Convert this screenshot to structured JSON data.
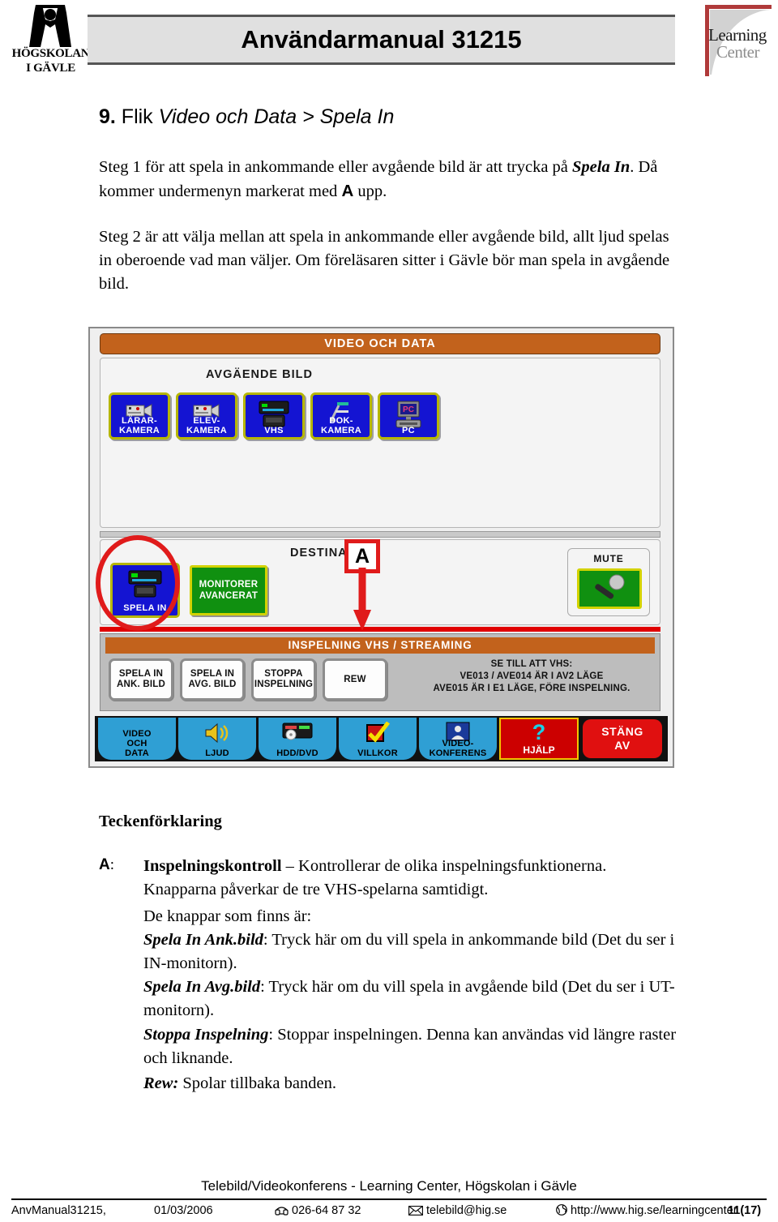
{
  "header": {
    "title": "Användarmanual 31215",
    "hig_logo_line1": "HÖGSKOLAN",
    "hig_logo_line2": "I GÄVLE",
    "lc_logo_line1": "Learning",
    "lc_logo_line2": "Center"
  },
  "section": {
    "number": "9.",
    "lead": " Flik ",
    "title_italic": "Video och Data > Spela In"
  },
  "paragraphs": {
    "p1_a": "Steg 1 för att spela in ankommande eller avgående bild är att trycka på ",
    "p1_b": "Spela In",
    "p1_c": ". Då kommer undermenyn markerat med ",
    "p1_d": "A",
    "p1_e": " upp.",
    "p2": "Steg 2 är att välja mellan att spela in ankommande eller avgående bild, allt ljud spelas in oberoende vad man väljer. Om föreläsaren sitter i Gävle bör man spela in avgående bild."
  },
  "panel": {
    "titlebar": "VIDEO OCH DATA",
    "outgoing_label": "AVGÄENDE BILD",
    "sources": [
      {
        "label_line1": "LÄRAR-",
        "label_line2": "KAMERA",
        "icon": "video-camera-icon"
      },
      {
        "label_line1": "ELEV-",
        "label_line2": "KAMERA",
        "icon": "video-camera-icon"
      },
      {
        "label_line1": "",
        "label_line2": "VHS",
        "icon": "vhs-deck-icon"
      },
      {
        "label_line1": "DOK-",
        "label_line2": "KAMERA",
        "icon": "document-camera-icon"
      },
      {
        "label_line1": "",
        "label_line2": "PC",
        "icon": "pc-monitor-icon"
      }
    ],
    "destination_label": "DESTINATION",
    "spela_in_label": "SPELA IN",
    "monitorer_line1": "MONITORER",
    "monitorer_line2": "AVANCERAT",
    "mute_label": "MUTE",
    "recording_titlebar": "INSPELNING VHS / STREAMING",
    "recording_buttons": [
      {
        "line1": "SPELA IN",
        "line2": "ANK. BILD"
      },
      {
        "line1": "SPELA IN",
        "line2": "AVG. BILD"
      },
      {
        "line1": "STOPPA",
        "line2": "INSPELNING"
      },
      {
        "line1": "REW",
        "line2": ""
      }
    ],
    "recording_note_line1": "SE TILL ATT VHS:",
    "recording_note_line2": "VE013 / AVE014 ÄR I AV2 LÄGE",
    "recording_note_line3": "AVE015 ÄR I E1 LÄGE, FÖRE INSPELNING.",
    "toolbar": [
      {
        "line1": "VIDEO",
        "line2": "OCH",
        "line3": "DATA",
        "icon": ""
      },
      {
        "line1": "LJUD",
        "line2": "",
        "line3": "",
        "icon": "speaker-icon"
      },
      {
        "line1": "HDD/DVD",
        "line2": "",
        "line3": "",
        "icon": "hdd-dvd-icon"
      },
      {
        "line1": "VILLKOR",
        "line2": "",
        "line3": "",
        "icon": "checkmark-icon"
      },
      {
        "line1": "VIDEO-",
        "line2": "KONFERENS",
        "line3": "",
        "icon": "videoconference-icon"
      }
    ],
    "help_label": "HJÄLP",
    "help_glyph": "?",
    "power_off_line1": "STÄNG",
    "power_off_line2": "AV"
  },
  "annotation": {
    "marker": "A",
    "ellipse_color": "#e01b1b"
  },
  "legend": {
    "title": "Teckenförklaring",
    "key": "A",
    "key_colon": ":",
    "item1_bold": "Inspelningskontroll",
    "item1_rest": " – Kontrollerar de olika inspelningsfunktionerna. Knapparna påverkar de tre VHS-spelarna samtidigt.",
    "item2": "De knappar som finns är:",
    "item3_bold": "Spela In Ank.bild",
    "item3_rest": ": Tryck här om du vill spela in ankommande bild (Det du ser i IN-monitorn).",
    "item4_bold": "Spela In Avg.bild",
    "item4_rest": ": Tryck här om du vill spela in avgående bild (Det du ser i UT-monitorn).",
    "item5_bold": "Stoppa Inspelning",
    "item5_rest": ": Stoppar inspelningen. Denna kan användas vid längre raster och liknande.",
    "item6_bold": "Rew:",
    "item6_rest": " Spolar tillbaka banden."
  },
  "footer": {
    "title": "Telebild/Videokonferens - Learning Center, Högskolan i Gävle",
    "document": "AnvManual31215,",
    "date": "01/03/2006",
    "phone": "026-64 87 32",
    "email": "telebild@hig.se",
    "web": "http://www.hig.se/learningcenter",
    "page": "11(17)"
  }
}
